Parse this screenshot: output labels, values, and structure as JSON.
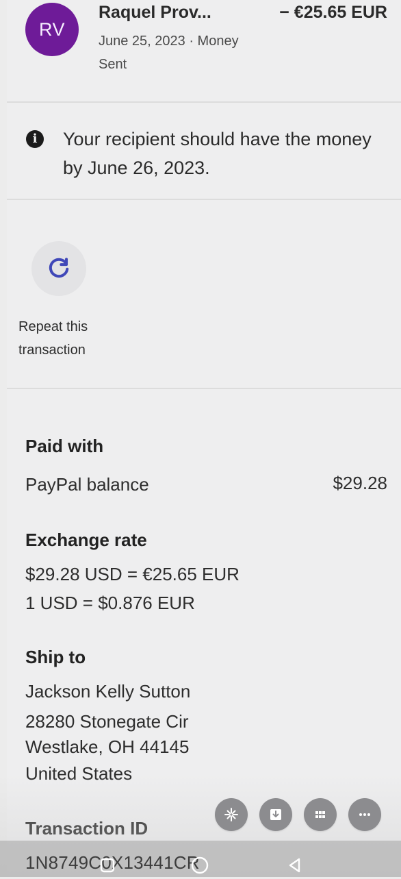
{
  "transaction": {
    "avatar_initials": "RV",
    "name": "Raquel Prov...",
    "amount": "− €25.65 EUR",
    "date_status": "June 25, 2023 · Money Sent"
  },
  "notice": {
    "text": "Your recipient should have the money by June 26, 2023."
  },
  "actions": {
    "repeat_label": "Repeat this transaction"
  },
  "paid_with": {
    "title": "Paid with",
    "method": "PayPal balance",
    "value": "$29.28"
  },
  "exchange_rate": {
    "title": "Exchange rate",
    "line1": "$29.28 USD = €25.65 EUR",
    "line2": "1 USD = $0.876 EUR"
  },
  "ship_to": {
    "title": "Ship to",
    "name": "Jackson Kelly Sutton",
    "street": "28280 Stonegate Cir",
    "city": "Westlake, OH 44145",
    "country": "United States"
  },
  "transaction_id": {
    "title": "Transaction ID",
    "value": "1N8749C0X13441CR"
  },
  "icons": {
    "info": "info-icon",
    "repeat": "refresh-icon",
    "fab1": "sparkle-icon",
    "fab2": "download-icon",
    "fab3": "grid-icon",
    "fab4": "more-icon",
    "nav1": "square-icon",
    "nav2": "home-circle-icon",
    "nav3": "back-triangle-icon"
  },
  "colors": {
    "avatar": "#6e1b98",
    "background": "#efeff0",
    "accent_icon": "#3f47b8"
  }
}
